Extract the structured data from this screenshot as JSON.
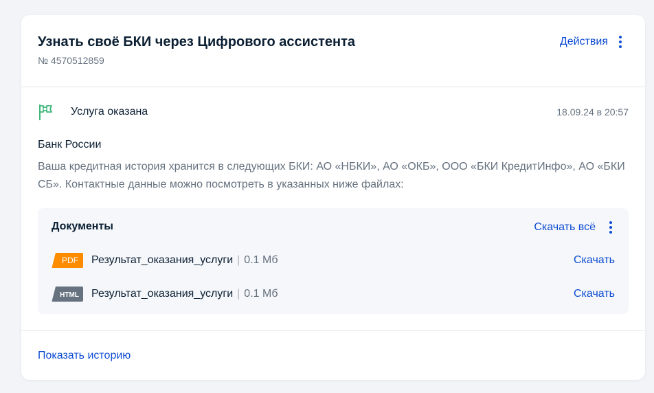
{
  "header": {
    "title": "Узнать своё БКИ через Цифрового ассистента",
    "order_number": "№ 4570512859",
    "actions_label": "Действия"
  },
  "status": {
    "icon": "flag-icon",
    "text": "Услуга оказана",
    "date": "18.09.24 в 20:57"
  },
  "message": {
    "organization": "Банк России",
    "body": "Ваша кредитная история хранится в следующих БКИ: АО «НБКИ», АО «ОКБ», ООО «БКИ КредитИнфо», АО «БКИ СБ». Контактные данные можно посмотреть в указанных ниже файлах:"
  },
  "documents": {
    "title": "Документы",
    "download_all_label": "Скачать всё",
    "separator": "|",
    "items": [
      {
        "type": "PDF",
        "name": "Результат_оказания_услуги",
        "size": "0.1 Мб",
        "download_label": "Скачать",
        "badge_color": "#ff8c00"
      },
      {
        "type": "HTML",
        "name": "Результат_оказания_услуги",
        "size": "0.1 Мб",
        "download_label": "Скачать",
        "badge_color": "#66727f"
      }
    ]
  },
  "footer": {
    "history_label": "Показать историю"
  },
  "colors": {
    "accent": "#0d4cd3",
    "status_flag": "#3fb77b",
    "text_primary": "#0b1f33",
    "text_secondary": "#66727f"
  }
}
